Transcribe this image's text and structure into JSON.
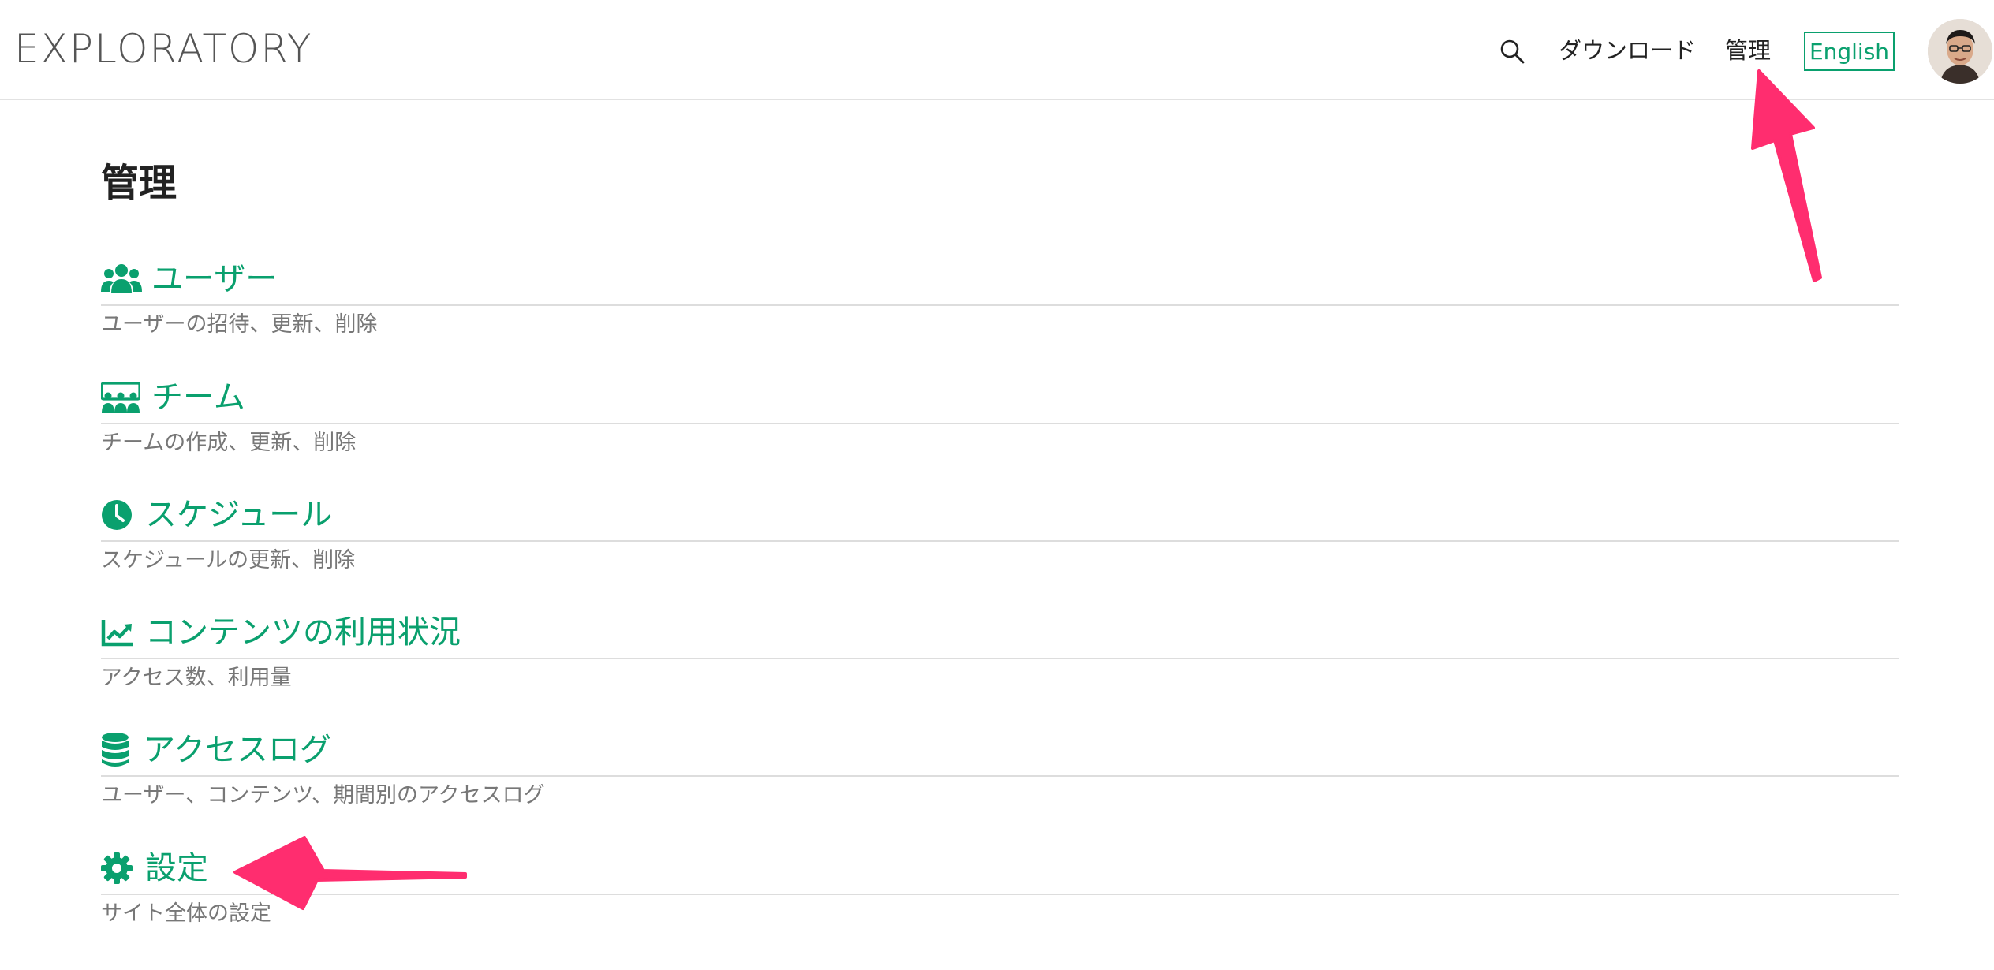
{
  "header": {
    "logo": "EXPLORATORY",
    "nav": {
      "download": "ダウンロード",
      "admin": "管理",
      "language": "English"
    }
  },
  "main": {
    "title": "管理",
    "sections": [
      {
        "label": "ユーザー",
        "description": "ユーザーの招待、更新、削除",
        "icon": "users-icon"
      },
      {
        "label": "チーム",
        "description": "チームの作成、更新、削除",
        "icon": "team-icon"
      },
      {
        "label": "スケジュール",
        "description": "スケジュールの更新、削除",
        "icon": "clock-icon"
      },
      {
        "label": "コンテンツの利用状況",
        "description": "アクセス数、利用量",
        "icon": "chart-line-icon"
      },
      {
        "label": "アクセスログ",
        "description": "ユーザー、コンテンツ、期間別のアクセスログ",
        "icon": "database-icon"
      },
      {
        "label": "設定",
        "description": "サイト全体の設定",
        "icon": "gear-icon"
      }
    ]
  },
  "colors": {
    "accent": "#0aa06e",
    "annotation_arrow": "#ff2d6f",
    "description_text": "#777777"
  }
}
